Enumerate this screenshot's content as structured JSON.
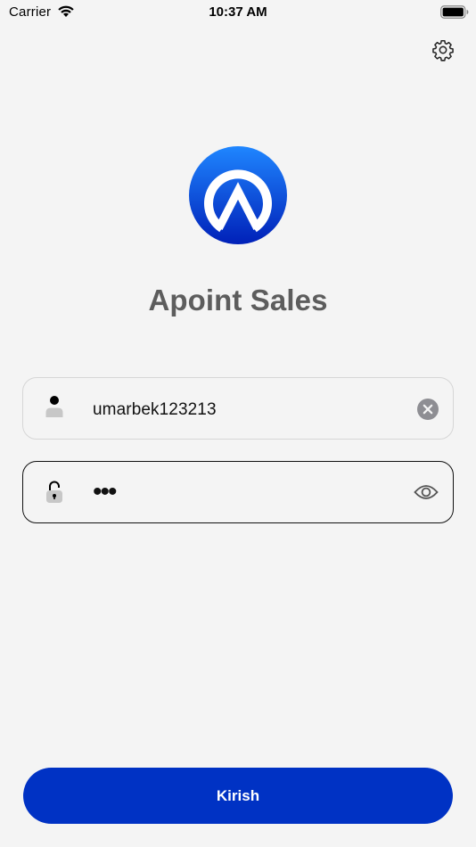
{
  "status_bar": {
    "carrier": "Carrier",
    "time": "10:37 AM",
    "wifi_icon": "wifi-icon",
    "battery_icon": "battery-icon"
  },
  "header": {
    "settings_icon": "gear-icon"
  },
  "brand": {
    "logo_icon": "apoint-logo",
    "title": "Apoint Sales",
    "colors": {
      "logo_gradient_top": "#1f86ff",
      "logo_gradient_bottom": "#0020b8",
      "title": "#5d5d5d"
    }
  },
  "form": {
    "username": {
      "icon": "user-icon",
      "value": "umarbek123213",
      "clear_icon": "clear-icon"
    },
    "password": {
      "icon": "lock-icon",
      "masked_value": "•••",
      "visibility_icon": "eye-icon"
    },
    "submit_label": "Kirish",
    "submit_color": "#0032c4"
  }
}
